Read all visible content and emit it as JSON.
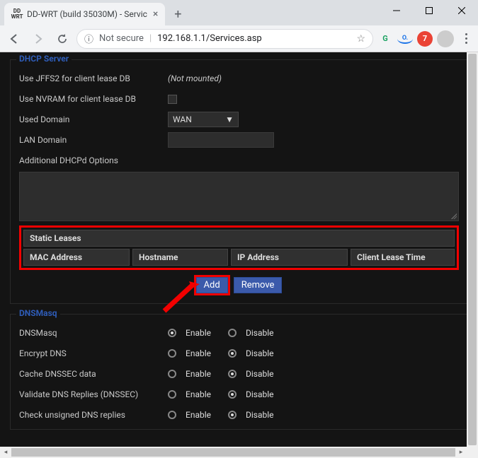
{
  "browser": {
    "tab_title": "DD-WRT (build 35030M) - Servic",
    "favicon_top": "DD",
    "favicon_bot": "WRT",
    "not_secure": "Not secure",
    "url": "192.168.1.1/Services.asp"
  },
  "dhcp": {
    "legend": "DHCP Server",
    "jffs2_label": "Use JFFS2 for client lease DB",
    "jffs2_note": "(Not mounted)",
    "nvram_label": "Use NVRAM for client lease DB",
    "used_domain_label": "Used Domain",
    "used_domain_value": "WAN",
    "lan_domain_label": "LAN Domain",
    "add_opts_label": "Additional DHCPd Options",
    "static_header": "Static Leases",
    "cols": {
      "mac": "MAC Address",
      "host": "Hostname",
      "ip": "IP Address",
      "time": "Client Lease Time"
    },
    "add": "Add",
    "remove": "Remove"
  },
  "dnsmasq": {
    "legend": "DNSMasq",
    "enable": "Enable",
    "disable": "Disable",
    "rows": [
      {
        "label": "DNSMasq",
        "checked": "enable"
      },
      {
        "label": "Encrypt DNS",
        "checked": "disable"
      },
      {
        "label": "Cache DNSSEC data",
        "checked": "disable"
      },
      {
        "label": "Validate DNS Replies (DNSSEC)",
        "checked": "disable"
      },
      {
        "label": "Check unsigned DNS replies",
        "checked": "disable"
      }
    ]
  }
}
